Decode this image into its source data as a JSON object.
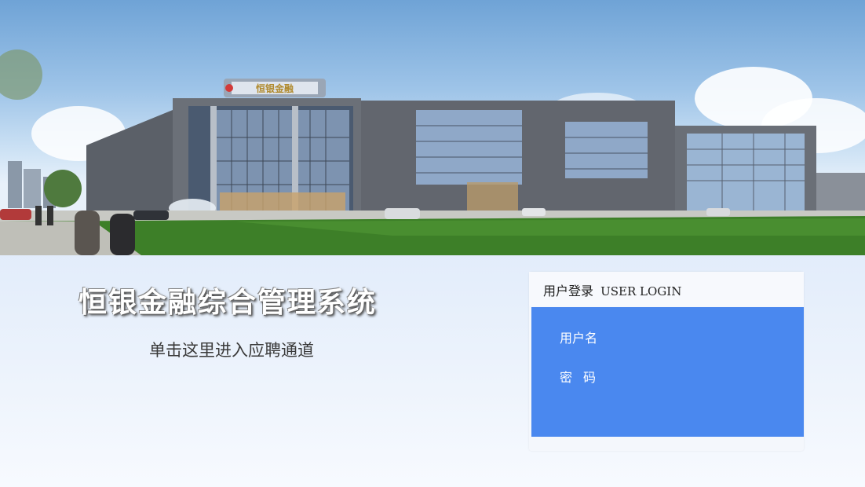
{
  "banner": {
    "building_sign": "恒银金融"
  },
  "main": {
    "system_title": "恒银金融综合管理系统",
    "recruit_link": "单击这里进入应聘通道"
  },
  "login": {
    "header_cn": "用户登录",
    "header_en": "USER LOGIN",
    "username_label": "用户名",
    "password_label": "密码",
    "username_value": "",
    "password_value": ""
  },
  "colors": {
    "login_body": "#4a88ef",
    "page_bg": "#dde9fa"
  }
}
